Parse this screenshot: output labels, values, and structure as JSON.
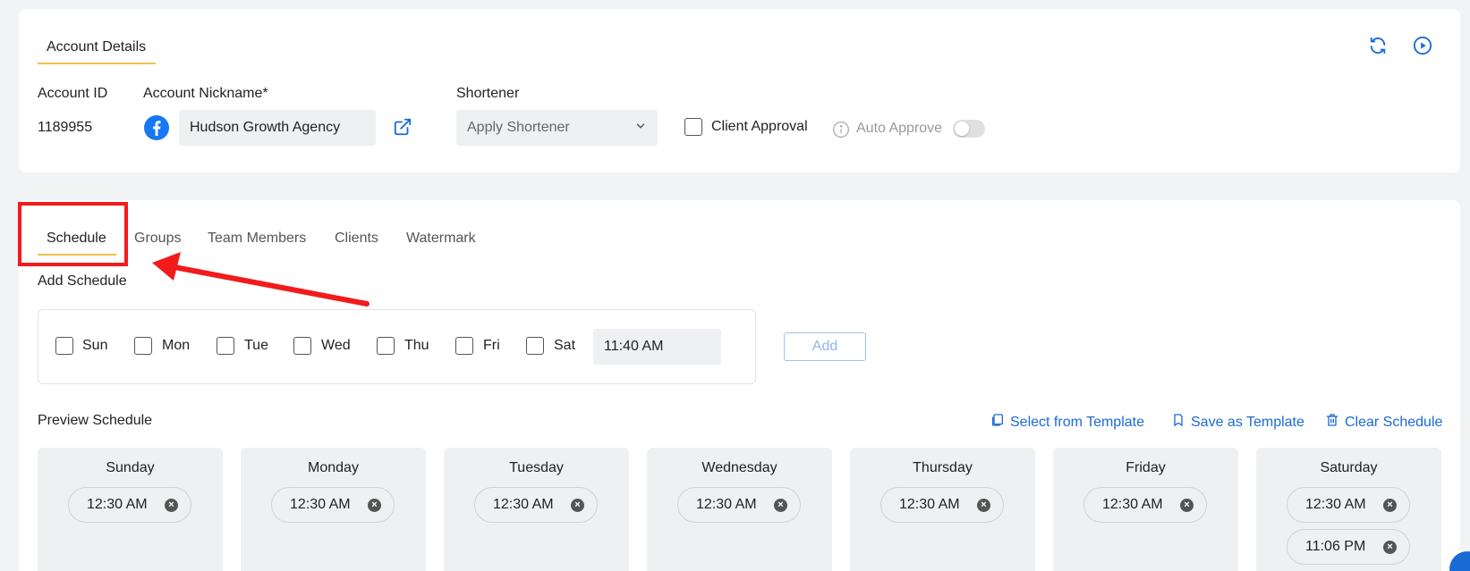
{
  "account": {
    "section_tab": "Account Details",
    "id_label": "Account ID",
    "id_value": "1189955",
    "nickname_label": "Account Nickname*",
    "nickname_value": "Hudson Growth Agency",
    "shortener_label": "Shortener",
    "shortener_value": "Apply Shortener",
    "client_approval_label": "Client Approval",
    "auto_approve_label": "Auto Approve"
  },
  "tabs": [
    "Schedule",
    "Groups",
    "Team Members",
    "Clients",
    "Watermark"
  ],
  "add_schedule": {
    "title": "Add Schedule",
    "days": [
      "Sun",
      "Mon",
      "Tue",
      "Wed",
      "Thu",
      "Fri",
      "Sat"
    ],
    "time_value": "11:40 AM",
    "add_label": "Add"
  },
  "preview": {
    "title": "Preview Schedule",
    "select_template": "Select from Template",
    "save_template": "Save as Template",
    "clear_schedule": "Clear Schedule",
    "days": [
      {
        "name": "Sunday",
        "times": [
          "12:30 AM"
        ]
      },
      {
        "name": "Monday",
        "times": [
          "12:30 AM"
        ]
      },
      {
        "name": "Tuesday",
        "times": [
          "12:30 AM"
        ]
      },
      {
        "name": "Wednesday",
        "times": [
          "12:30 AM"
        ]
      },
      {
        "name": "Thursday",
        "times": [
          "12:30 AM"
        ]
      },
      {
        "name": "Friday",
        "times": [
          "12:30 AM"
        ]
      },
      {
        "name": "Saturday",
        "times": [
          "12:30 AM",
          "11:06 PM"
        ]
      }
    ]
  },
  "colors": {
    "accent": "#1a6ad6",
    "tab_underline": "#f2c14e",
    "annotation_red": "#f21b1b",
    "facebook_blue": "#1877f2"
  }
}
